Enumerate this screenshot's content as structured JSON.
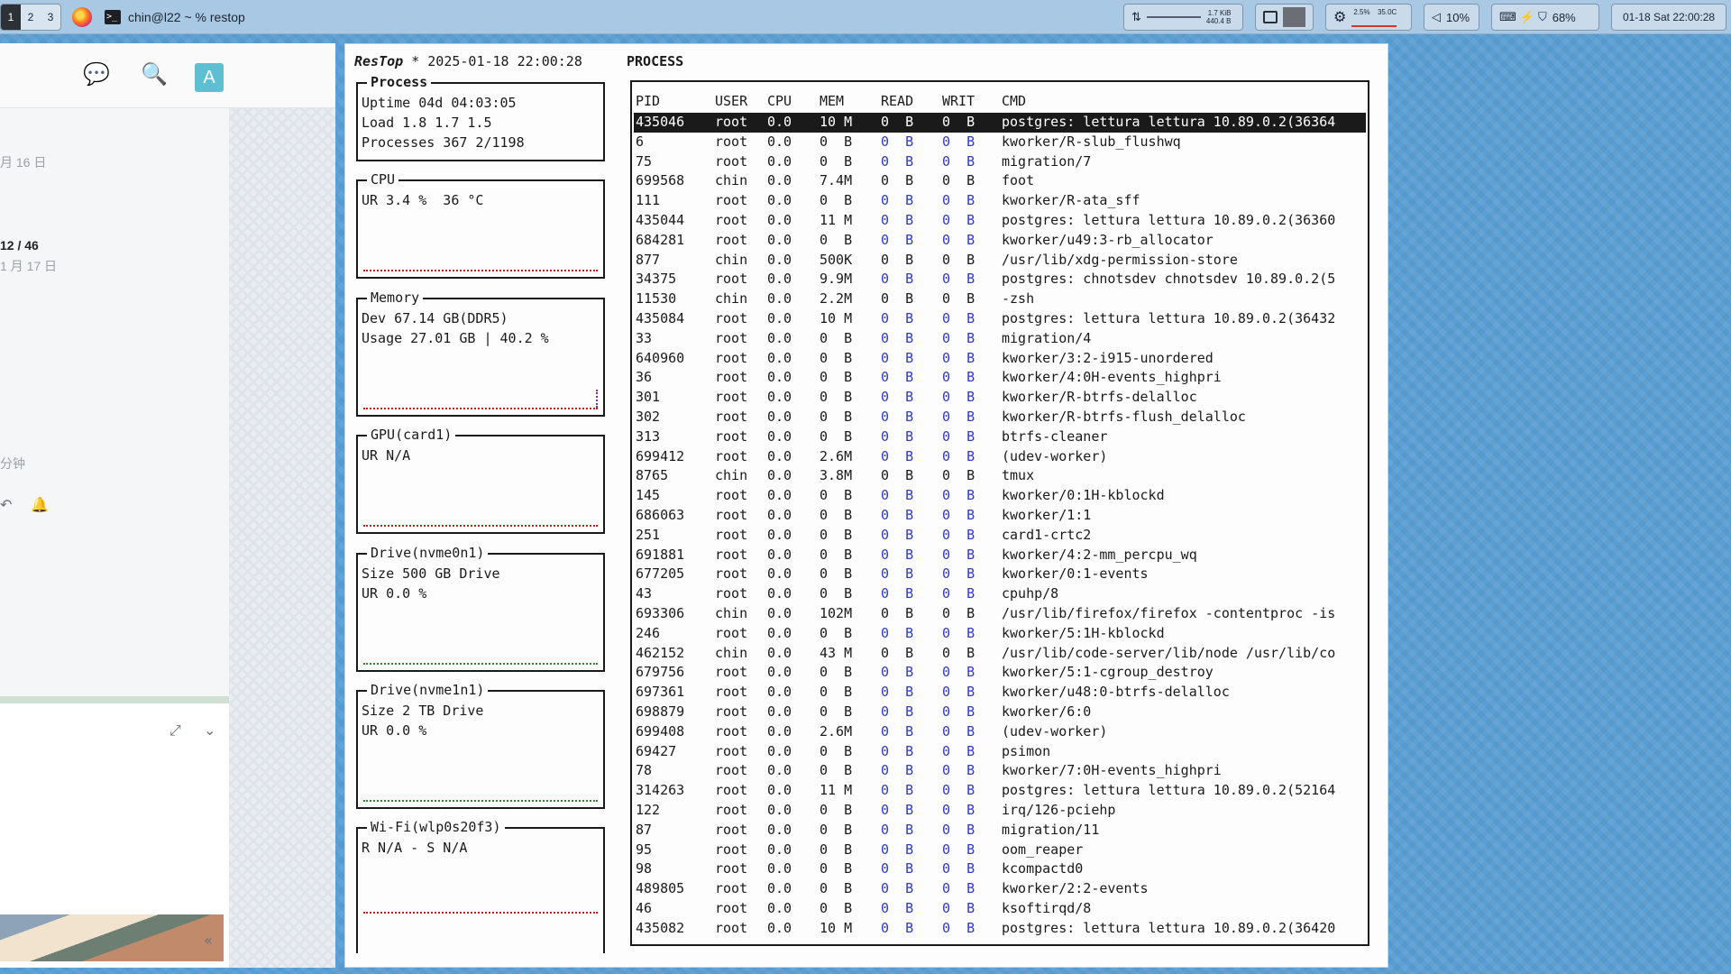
{
  "topbar": {
    "workspaces": [
      "1",
      "2",
      "3"
    ],
    "window_title": "chin@l22 ~ % restop",
    "net_up": "1.7 KiB",
    "net_down": "440.4 B",
    "cpu_usage": "2.5%",
    "cpu_temp": "35.0C",
    "volume": "10%",
    "battery": "68%",
    "clock": "01-18 Sat 22:00:28"
  },
  "leftpanel": {
    "avatar_letter": "A",
    "date1": "月 16 日",
    "count": "12 / 46",
    "date2": "1 月 17 日",
    "minutes": "分钟"
  },
  "terminal": {
    "app_name": "ResTop",
    "header_rest": " * 2025-01-18 22:00:28",
    "process_title": "PROCESS",
    "process_box": {
      "legend": "Process",
      "uptime": "Uptime 04d 04:03:05",
      "load": "Load 1.8 1.7 1.5",
      "processes": "Processes 367 2/1198"
    },
    "cpu_box": {
      "legend": "CPU",
      "line1": "UR 3.4 %  36 °C"
    },
    "memory_box": {
      "legend": "Memory",
      "line1": "Dev 67.14 GB(DDR5)",
      "line2": "Usage 27.01 GB | 40.2 %"
    },
    "gpu_box": {
      "legend": "GPU(card1)",
      "line1": "UR N/A"
    },
    "drive1_box": {
      "legend": "Drive(nvme0n1)",
      "line1": "Size 500 GB Drive",
      "line2": "UR 0.0 %"
    },
    "drive2_box": {
      "legend": "Drive(nvme1n1)",
      "line1": "Size 2 TB Drive",
      "line2": "UR 0.0 %"
    },
    "wifi_box": {
      "legend": "Wi-Fi(wlp0s20f3)",
      "line1": "R N/A - S N/A"
    },
    "columns": [
      "PID",
      "USER",
      "CPU",
      "MEM",
      "READ",
      "WRIT",
      "CMD"
    ],
    "rows": [
      [
        "435046",
        "root",
        "0.0",
        "10 M",
        "0  B",
        "0  B",
        "postgres: lettura lettura 10.89.0.2(36364"
      ],
      [
        "6",
        "root",
        "0.0",
        "0  B",
        "0  B",
        "0  B",
        "kworker/R-slub_flushwq"
      ],
      [
        "75",
        "root",
        "0.0",
        "0  B",
        "0  B",
        "0  B",
        "migration/7"
      ],
      [
        "699568",
        "chin",
        "0.0",
        "7.4M",
        "0  B",
        "0  B",
        "foot"
      ],
      [
        "111",
        "root",
        "0.0",
        "0  B",
        "0  B",
        "0  B",
        "kworker/R-ata_sff"
      ],
      [
        "435044",
        "root",
        "0.0",
        "11 M",
        "0  B",
        "0  B",
        "postgres: lettura lettura 10.89.0.2(36360"
      ],
      [
        "684281",
        "root",
        "0.0",
        "0  B",
        "0  B",
        "0  B",
        "kworker/u49:3-rb_allocator"
      ],
      [
        "877",
        "chin",
        "0.0",
        "500K",
        "0  B",
        "0  B",
        "/usr/lib/xdg-permission-store"
      ],
      [
        "34375",
        "root",
        "0.0",
        "9.9M",
        "0  B",
        "0  B",
        "postgres: chnotsdev chnotsdev 10.89.0.2(5"
      ],
      [
        "11530",
        "chin",
        "0.0",
        "2.2M",
        "0  B",
        "0  B",
        "-zsh"
      ],
      [
        "435084",
        "root",
        "0.0",
        "10 M",
        "0  B",
        "0  B",
        "postgres: lettura lettura 10.89.0.2(36432"
      ],
      [
        "33",
        "root",
        "0.0",
        "0  B",
        "0  B",
        "0  B",
        "migration/4"
      ],
      [
        "640960",
        "root",
        "0.0",
        "0  B",
        "0  B",
        "0  B",
        "kworker/3:2-i915-unordered"
      ],
      [
        "36",
        "root",
        "0.0",
        "0  B",
        "0  B",
        "0  B",
        "kworker/4:0H-events_highpri"
      ],
      [
        "301",
        "root",
        "0.0",
        "0  B",
        "0  B",
        "0  B",
        "kworker/R-btrfs-delalloc"
      ],
      [
        "302",
        "root",
        "0.0",
        "0  B",
        "0  B",
        "0  B",
        "kworker/R-btrfs-flush_delalloc"
      ],
      [
        "313",
        "root",
        "0.0",
        "0  B",
        "0  B",
        "0  B",
        "btrfs-cleaner"
      ],
      [
        "699412",
        "root",
        "0.0",
        "2.6M",
        "0  B",
        "0  B",
        "(udev-worker)"
      ],
      [
        "8765",
        "chin",
        "0.0",
        "3.8M",
        "0  B",
        "0  B",
        "tmux"
      ],
      [
        "145",
        "root",
        "0.0",
        "0  B",
        "0  B",
        "0  B",
        "kworker/0:1H-kblockd"
      ],
      [
        "686063",
        "root",
        "0.0",
        "0  B",
        "0  B",
        "0  B",
        "kworker/1:1"
      ],
      [
        "251",
        "root",
        "0.0",
        "0  B",
        "0  B",
        "0  B",
        "card1-crtc2"
      ],
      [
        "691881",
        "root",
        "0.0",
        "0  B",
        "0  B",
        "0  B",
        "kworker/4:2-mm_percpu_wq"
      ],
      [
        "677205",
        "root",
        "0.0",
        "0  B",
        "0  B",
        "0  B",
        "kworker/0:1-events"
      ],
      [
        "43",
        "root",
        "0.0",
        "0  B",
        "0  B",
        "0  B",
        "cpuhp/8"
      ],
      [
        "693306",
        "chin",
        "0.0",
        "102M",
        "0  B",
        "0  B",
        "/usr/lib/firefox/firefox -contentproc -is"
      ],
      [
        "246",
        "root",
        "0.0",
        "0  B",
        "0  B",
        "0  B",
        "kworker/5:1H-kblockd"
      ],
      [
        "462152",
        "chin",
        "0.0",
        "43 M",
        "0  B",
        "0  B",
        "/usr/lib/code-server/lib/node /usr/lib/co"
      ],
      [
        "679756",
        "root",
        "0.0",
        "0  B",
        "0  B",
        "0  B",
        "kworker/5:1-cgroup_destroy"
      ],
      [
        "697361",
        "root",
        "0.0",
        "0  B",
        "0  B",
        "0  B",
        "kworker/u48:0-btrfs-delalloc"
      ],
      [
        "698879",
        "root",
        "0.0",
        "0  B",
        "0  B",
        "0  B",
        "kworker/6:0"
      ],
      [
        "699408",
        "root",
        "0.0",
        "2.6M",
        "0  B",
        "0  B",
        "(udev-worker)"
      ],
      [
        "69427",
        "root",
        "0.0",
        "0  B",
        "0  B",
        "0  B",
        "psimon"
      ],
      [
        "78",
        "root",
        "0.0",
        "0  B",
        "0  B",
        "0  B",
        "kworker/7:0H-events_highpri"
      ],
      [
        "314263",
        "root",
        "0.0",
        "11 M",
        "0  B",
        "0  B",
        "postgres: lettura lettura 10.89.0.2(52164"
      ],
      [
        "122",
        "root",
        "0.0",
        "0  B",
        "0  B",
        "0  B",
        "irq/126-pciehp"
      ],
      [
        "87",
        "root",
        "0.0",
        "0  B",
        "0  B",
        "0  B",
        "migration/11"
      ],
      [
        "95",
        "root",
        "0.0",
        "0  B",
        "0  B",
        "0  B",
        "oom_reaper"
      ],
      [
        "98",
        "root",
        "0.0",
        "0  B",
        "0  B",
        "0  B",
        "kcompactd0"
      ],
      [
        "489805",
        "root",
        "0.0",
        "0  B",
        "0  B",
        "0  B",
        "kworker/2:2-events"
      ],
      [
        "46",
        "root",
        "0.0",
        "0  B",
        "0  B",
        "0  B",
        "ksoftirqd/8"
      ],
      [
        "435082",
        "root",
        "0.0",
        "10 M",
        "0  B",
        "0  B",
        "postgres: lettura lettura 10.89.0.2(36420"
      ]
    ]
  }
}
